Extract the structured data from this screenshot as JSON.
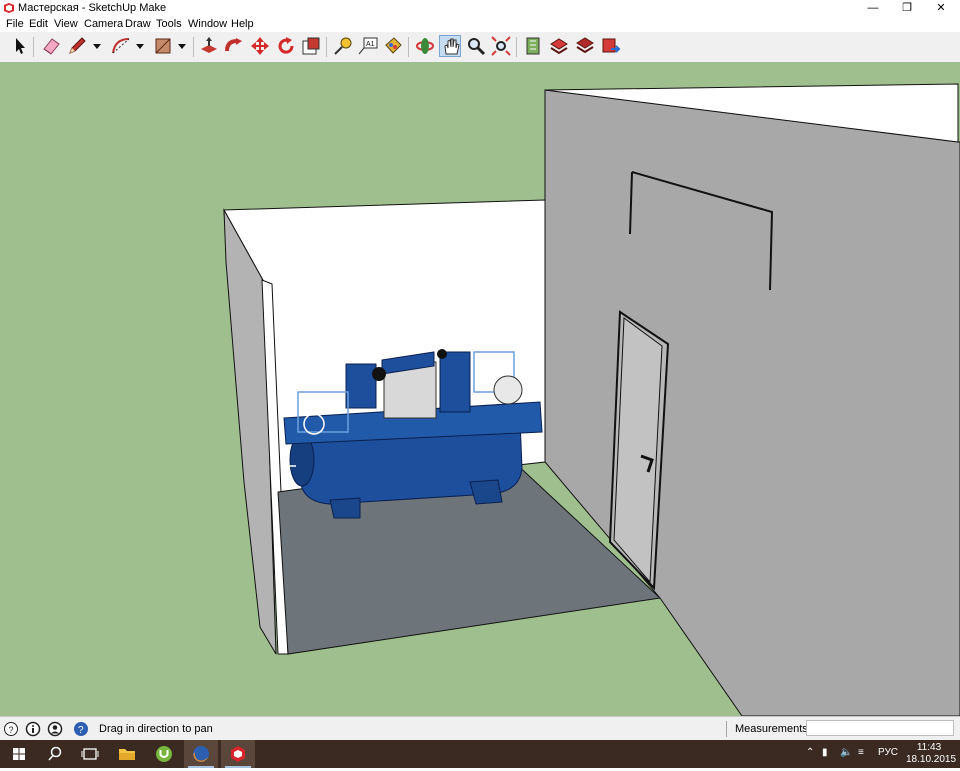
{
  "window": {
    "title": "Мастерская - SketchUp Make",
    "icon": "sketchup-icon",
    "controls": [
      "minimize-icon",
      "restore-icon",
      "close-icon"
    ]
  },
  "menu": [
    "File",
    "Edit",
    "View",
    "Camera",
    "Draw",
    "Tools",
    "Window",
    "Help"
  ],
  "toolbar": [
    "select-icon",
    "eraser-icon",
    "pencil-icon",
    "arc-icon",
    "rectangle-icon",
    "push-pull-icon",
    "follow-me-icon",
    "move-icon",
    "rotate-icon",
    "scale-icon",
    "tape-measure-icon",
    "text-icon",
    "paint-bucket-icon",
    "orbit-icon",
    "pan-icon",
    "zoom-icon",
    "zoom-extents-icon",
    "warehouse-icon",
    "share-model-icon",
    "get-models-icon",
    "extension-icon"
  ],
  "status": {
    "hint": "Drag in direction to pan",
    "measurements_label": "Measurements",
    "measurements_value": ""
  },
  "taskbar": {
    "apps": [
      "windows-start-icon",
      "search-icon",
      "task-view-icon",
      "file-explorer-icon",
      "utorrent-icon",
      "firefox-icon",
      "sketchup-icon"
    ],
    "language": "РУС",
    "time": "11:43",
    "date": "18.10.2015"
  },
  "colors": {
    "ground": "#9fbf8e",
    "wall": "#a8a8a8",
    "floor": "#6e757a",
    "compressor": "#1d4f9c",
    "taskbar": "#3a2a22"
  }
}
